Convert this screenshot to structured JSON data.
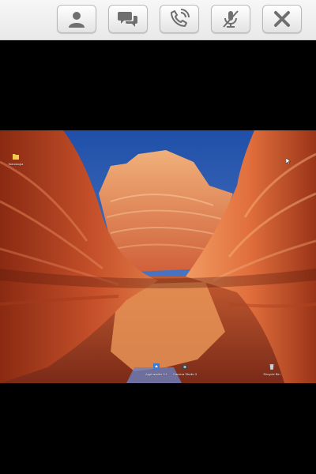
{
  "toolbar": {
    "buttons": [
      {
        "id": "contact",
        "icon": "person-icon"
      },
      {
        "id": "chat",
        "icon": "chat-bubbles-icon"
      },
      {
        "id": "call",
        "icon": "phone-call-icon"
      },
      {
        "id": "mute",
        "icon": "microphone-muted-icon"
      },
      {
        "id": "close",
        "icon": "close-icon"
      }
    ]
  },
  "desktop": {
    "wallpaper": "red-sandstone-canyon",
    "icons": [
      {
        "label": "Wandoujia",
        "icon": "folder-icon"
      },
      {
        "label": "AppInstaller 3.1",
        "icon": "app-icon"
      },
      {
        "label": "Camera Studio 3",
        "icon": "camera-icon"
      },
      {
        "label": "Recycle Bin",
        "icon": "recycle-bin-icon"
      }
    ]
  },
  "colors": {
    "toolbar_bg": "#eeeeee",
    "icon_gray": "#6f6f6f",
    "letterbox": "#000000",
    "sky": "#2f5fb0",
    "rock": "#c8552a"
  }
}
